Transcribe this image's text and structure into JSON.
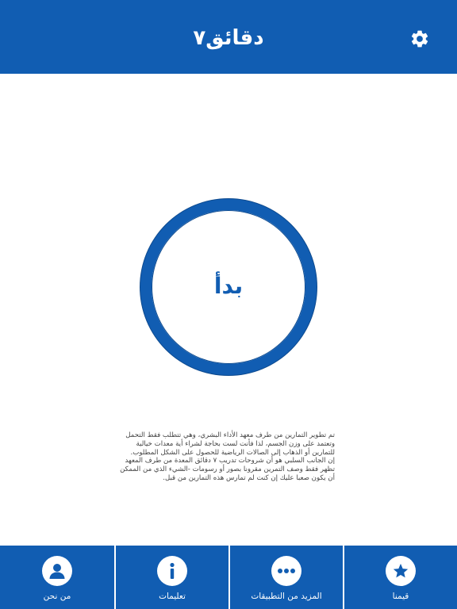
{
  "colors": {
    "brand": "#115db2",
    "background": "#ffffff",
    "text": "#444444"
  },
  "header": {
    "title": "دقائق٧",
    "settings_icon": "gear-icon"
  },
  "start": {
    "label": "بدأ"
  },
  "description": {
    "lines": [
      "تم تطوير التمارين من طرف معهد الأداء البشري، وهي تتطلب فقط التحمل",
      "وتعتمد على وزن الجسم، لذا فأنت لست بحاجة لشراء أية معدات خيالية",
      "للتمارين أو الذهاب إلى الصالات الرياضية للحصول على الشكل المطلوب.",
      "إن الجانب السلبي هو أن شروحات تدريب ٧ دقائق المعدة من طرف المعهد",
      "تظهر فقط وصف التمرين مقرونا بصور أو رسومات -الشيء الذي من الممكن",
      "أن يكون صعبا عليك إن كنت لم تمارس هذه التمارين من قبل."
    ]
  },
  "tabs": [
    {
      "label": "من نحن",
      "icon": "person-icon"
    },
    {
      "label": "تعليمات",
      "icon": "info-icon"
    },
    {
      "label": "المزيد من التطبيقات",
      "icon": "more-icon"
    },
    {
      "label": "قيمنا",
      "icon": "star-icon"
    }
  ]
}
